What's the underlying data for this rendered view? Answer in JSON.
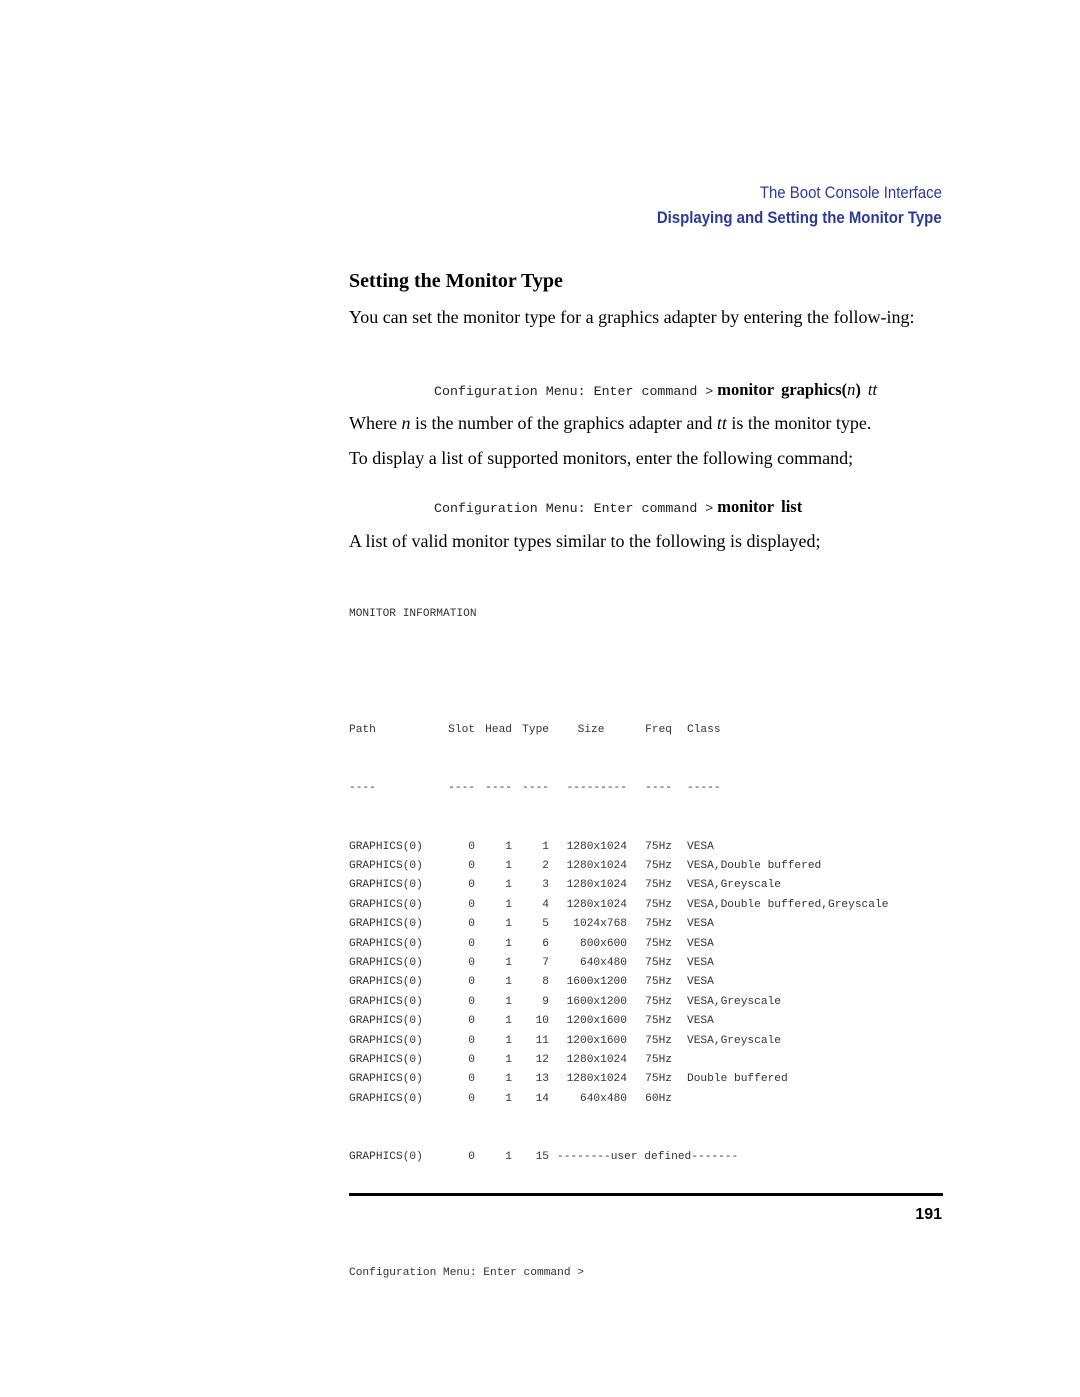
{
  "running_header": {
    "chapter": "The Boot Console Interface",
    "section": "Displaying and Setting the Monitor Type"
  },
  "section_title": "Setting the Monitor Type",
  "intro_paragraph": "You can set the monitor type for a graphics adapter by entering the follow-ing:",
  "command1": {
    "prompt": "Configuration Menu: Enter command >",
    "keyword1": "monitor",
    "keyword2": "graphics(",
    "arg_n": "n",
    "close_paren": ")",
    "arg_tt": "tt"
  },
  "explanation": {
    "where": "Where ",
    "n": "n",
    "middle": " is the number of the graphics adapter and ",
    "tt": "tt",
    "end": " is the monitor type."
  },
  "list_intro": "To display a list of supported monitors, enter the following command;",
  "command2": {
    "prompt": "Configuration Menu: Enter command >",
    "keyword1": "monitor",
    "keyword2": "list"
  },
  "result_intro": "A list of valid monitor types similar to the following is displayed;",
  "console_output": {
    "heading": "MONITOR INFORMATION",
    "columns": [
      "Path",
      "Slot",
      "Head",
      "Type",
      "Size",
      "Freq",
      "Class"
    ],
    "underlines": [
      "----",
      "----",
      "----",
      "----",
      "---------",
      "----",
      "-----"
    ],
    "rows": [
      [
        "GRAPHICS(0)",
        "0",
        "1",
        "1",
        "1280x1024",
        "75Hz",
        "VESA"
      ],
      [
        "GRAPHICS(0)",
        "0",
        "1",
        "2",
        "1280x1024",
        "75Hz",
        "VESA,Double buffered"
      ],
      [
        "GRAPHICS(0)",
        "0",
        "1",
        "3",
        "1280x1024",
        "75Hz",
        "VESA,Greyscale"
      ],
      [
        "GRAPHICS(0)",
        "0",
        "1",
        "4",
        "1280x1024",
        "75Hz",
        "VESA,Double buffered,Greyscale"
      ],
      [
        "GRAPHICS(0)",
        "0",
        "1",
        "5",
        "1024x768",
        "75Hz",
        "VESA"
      ],
      [
        "GRAPHICS(0)",
        "0",
        "1",
        "6",
        "800x600",
        "75Hz",
        "VESA"
      ],
      [
        "GRAPHICS(0)",
        "0",
        "1",
        "7",
        "640x480",
        "75Hz",
        "VESA"
      ],
      [
        "GRAPHICS(0)",
        "0",
        "1",
        "8",
        "1600x1200",
        "75Hz",
        "VESA"
      ],
      [
        "GRAPHICS(0)",
        "0",
        "1",
        "9",
        "1600x1200",
        "75Hz",
        "VESA,Greyscale"
      ],
      [
        "GRAPHICS(0)",
        "0",
        "1",
        "10",
        "1200x1600",
        "75Hz",
        "VESA"
      ],
      [
        "GRAPHICS(0)",
        "0",
        "1",
        "11",
        "1200x1600",
        "75Hz",
        "VESA,Greyscale"
      ],
      [
        "GRAPHICS(0)",
        "0",
        "1",
        "12",
        "1280x1024",
        "75Hz",
        ""
      ],
      [
        "GRAPHICS(0)",
        "0",
        "1",
        "13",
        "1280x1024",
        "75Hz",
        "Double buffered"
      ],
      [
        "GRAPHICS(0)",
        "0",
        "1",
        "14",
        "640x480",
        "60Hz",
        ""
      ]
    ],
    "last_row": {
      "path": "GRAPHICS(0)",
      "slot": "0",
      "head": "1",
      "type": "15",
      "text": "--------user defined-------"
    },
    "final_prompt": "Configuration Menu: Enter command >"
  },
  "page_number": "191"
}
